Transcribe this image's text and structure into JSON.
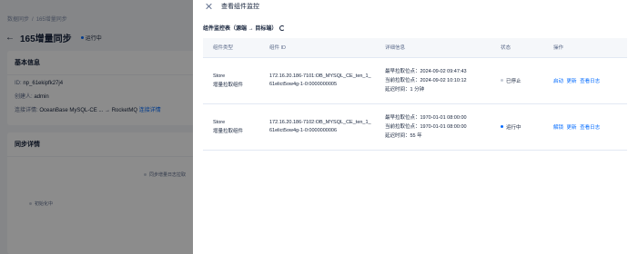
{
  "background": {
    "breadcrumb": [
      "数据同步",
      "165增量同步"
    ],
    "title": "165增量同步",
    "status_label": "运行中",
    "basic_info_title": "基本信息",
    "id_label": "ID:",
    "id_value": "np_61ekipfk27j4",
    "creator_label": "创建人:",
    "creator_value": "admin",
    "connection_label": "连接详情:",
    "connection_value": "OceanBase MySQL-CE ...",
    "connection_target": "RocketMQ",
    "connection_link": "连接详情",
    "sync_detail_title": "同步详情",
    "step1": "同步增量日志拉取",
    "step2": "初始化中"
  },
  "drawer": {
    "title": "查看组件监控",
    "section_title": "组件监控表（源端 → 目标端）",
    "columns": [
      "组件类型",
      "组件 ID",
      "详细信息",
      "状态",
      "操作"
    ],
    "rows": [
      {
        "type": [
          "Store",
          "增量拉取组件"
        ],
        "id": [
          "172.16.20.186-7101:OB_MYSQL_CE_ten_1_",
          "61elict5ow4g-1-0:0000000005"
        ],
        "details": [
          "最早拉取位点：2024-09-02 09:47:43",
          "当前拉取位点：2024-09-02 10:10:12",
          "延迟时间：1 分钟"
        ],
        "status": "已停止",
        "status_color": "#c5cbd6",
        "actions": [
          "启动",
          "更新",
          "查看日志"
        ]
      },
      {
        "type": [
          "Store",
          "增量拉取组件"
        ],
        "id": [
          "172.16.20.186-7102:OB_MYSQL_CE_ten_1_",
          "61elict5ow4g-1-0:0000000006"
        ],
        "details": [
          "最早拉取位点：1970-01-01 08:00:00",
          "当前拉取位点：1970-01-01 08:00:00",
          "延迟时间：55 年"
        ],
        "status": "运行中",
        "status_color": "#006aff",
        "actions": [
          "解锁",
          "更新",
          "查看日志"
        ]
      }
    ]
  },
  "colors": {
    "accent": "#006aff",
    "mask": "rgba(0,0,0,0.45)"
  }
}
